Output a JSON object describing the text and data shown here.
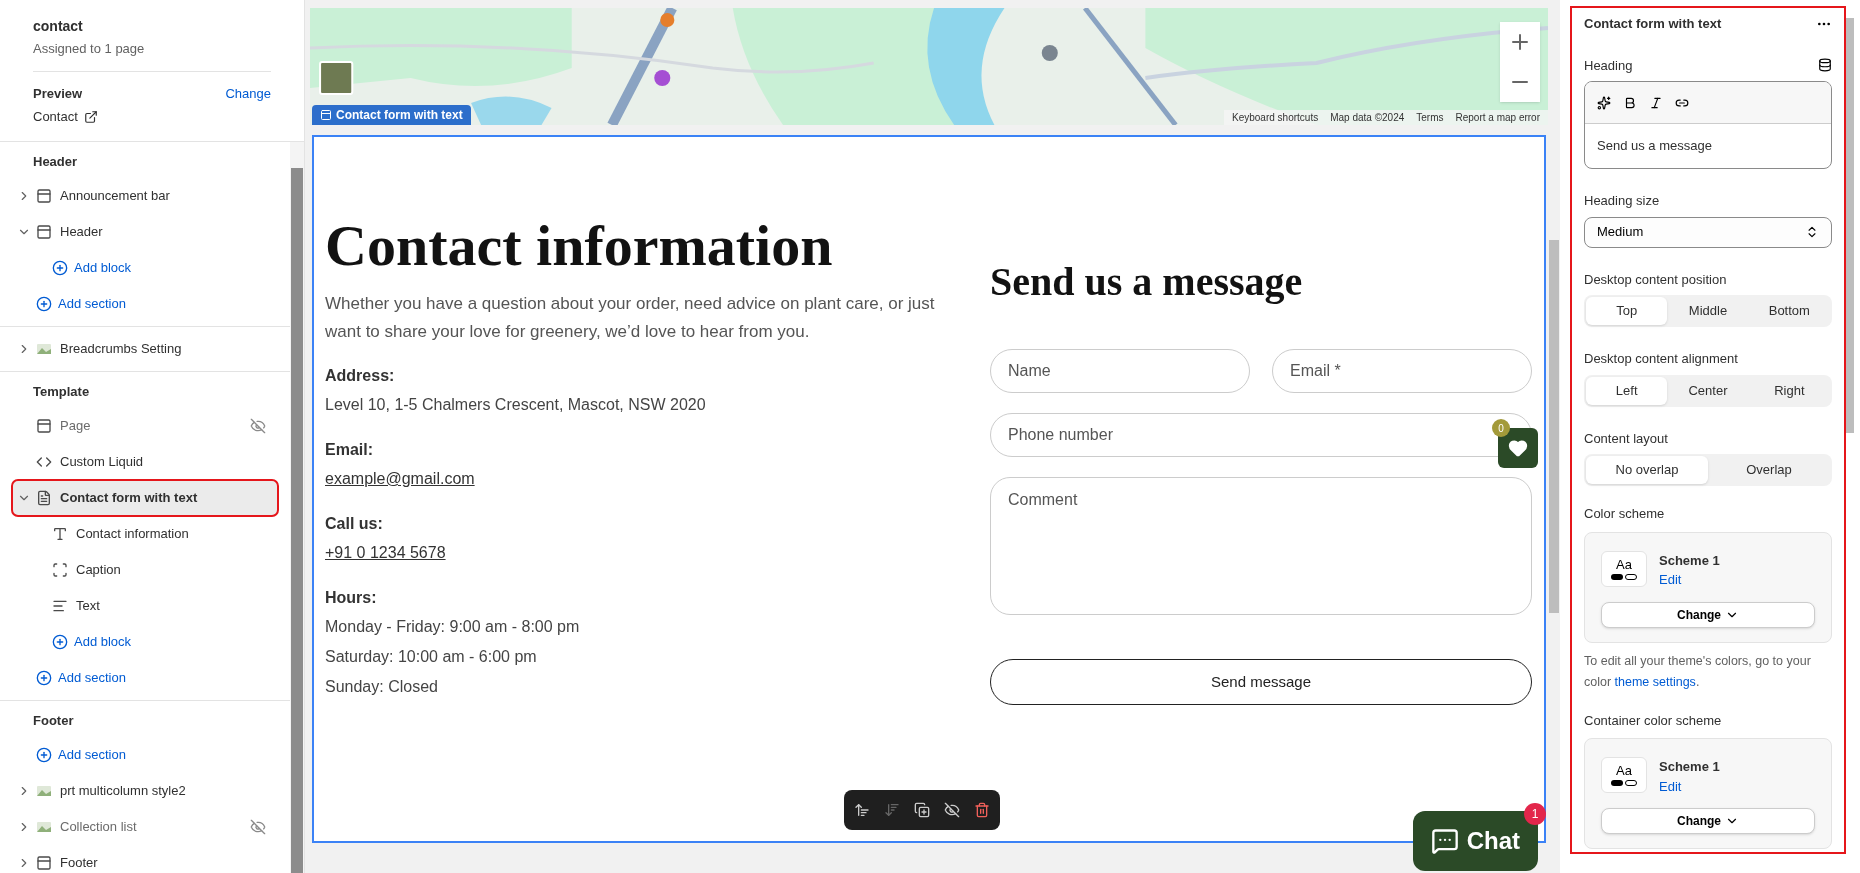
{
  "sidebar": {
    "title": "contact",
    "subtitle": "Assigned to 1 page",
    "preview_label": "Preview",
    "change_link": "Change",
    "preview_page": "Contact",
    "groups": [
      {
        "heading": "Header",
        "items": [
          {
            "kind": "layout",
            "label": "Announcement bar",
            "expanded": false,
            "hidden": false,
            "selected": false
          },
          {
            "kind": "layout",
            "label": "Header",
            "expanded": true,
            "hidden": false,
            "selected": false,
            "children": [
              {
                "kind": "add_block",
                "label": "Add block"
              }
            ]
          },
          {
            "kind": "add_section",
            "label": "Add section"
          }
        ]
      },
      {
        "items": [
          {
            "kind": "thumbnail",
            "label": "Breadcrumbs Setting",
            "expanded": false,
            "hidden": false,
            "selected": false
          }
        ]
      },
      {
        "heading": "Template",
        "items": [
          {
            "kind": "layout",
            "label": "Page",
            "hidden": true,
            "selected": false
          },
          {
            "kind": "code",
            "label": "Custom Liquid",
            "hidden": false,
            "selected": false
          },
          {
            "kind": "form",
            "label": "Contact form with text",
            "expanded": true,
            "hidden": false,
            "selected": true,
            "children": [
              {
                "kind": "heading",
                "label": "Contact information"
              },
              {
                "kind": "caption",
                "label": "Caption"
              },
              {
                "kind": "paragraph",
                "label": "Text"
              },
              {
                "kind": "add_block",
                "label": "Add block"
              }
            ]
          },
          {
            "kind": "add_section",
            "label": "Add section"
          }
        ]
      },
      {
        "heading": "Footer",
        "items": [
          {
            "kind": "add_section",
            "label": "Add section"
          },
          {
            "kind": "thumbnail",
            "label": "prt multicolumn style2",
            "expanded": false,
            "hidden": false,
            "selected": false
          },
          {
            "kind": "thumbnail",
            "label": "Collection list",
            "expanded": false,
            "hidden": true,
            "selected": false
          },
          {
            "kind": "layout",
            "label": "Footer",
            "expanded": false,
            "hidden": false,
            "selected": false
          }
        ]
      }
    ]
  },
  "preview": {
    "map": {
      "kind": "picture",
      "attribution": [
        "Keyboard shortcuts",
        "Map data ©2024",
        "Terms",
        "Report a map error"
      ]
    },
    "section_tag": "Contact form with text",
    "contact": {
      "heading": "Contact information",
      "intro": "Whether you have a question about your order, need advice on plant care, or just want to share your love for greenery, we’d love to hear from you.",
      "details": [
        {
          "label": "Address:",
          "lines": [
            "Level 10, 1-5 Chalmers Crescent, Mascot, NSW 2020"
          ],
          "link": false
        },
        {
          "label": "Email:",
          "lines": [
            "example@gmail.com"
          ],
          "link": true
        },
        {
          "label": "Call us:",
          "lines": [
            "+91 0 1234 5678"
          ],
          "link": true
        },
        {
          "label": "Hours:",
          "lines": [
            "Monday - Friday: 9:00 am - 8:00 pm",
            "Saturday: 10:00 am - 6:00 pm",
            "Sunday: Closed"
          ],
          "link": false
        }
      ]
    },
    "form": {
      "heading": "Send us a message",
      "fields": [
        {
          "kind": "half",
          "placeholder": "Name"
        },
        {
          "kind": "half",
          "placeholder": "Email *"
        },
        {
          "kind": "full",
          "placeholder": "Phone number"
        },
        {
          "kind": "textarea",
          "placeholder": "Comment"
        }
      ],
      "submit": "Send message"
    },
    "wishlist_count": "0",
    "chat": {
      "label": "Chat",
      "badge": "1"
    }
  },
  "settings": {
    "title": "Contact form with text",
    "heading_label": "Heading",
    "heading_value": "Send us a message",
    "size_label": "Heading size",
    "size_value": "Medium",
    "segments": [
      {
        "label": "Desktop content position",
        "options": [
          {
            "label": "Top",
            "selected": true
          },
          {
            "label": "Middle",
            "selected": false
          },
          {
            "label": "Bottom",
            "selected": false
          }
        ]
      },
      {
        "label": "Desktop content alignment",
        "options": [
          {
            "label": "Left",
            "selected": true
          },
          {
            "label": "Center",
            "selected": false
          },
          {
            "label": "Right",
            "selected": false
          }
        ]
      },
      {
        "label": "Content layout",
        "options": [
          {
            "label": "No overlap",
            "selected": true
          },
          {
            "label": "Overlap",
            "selected": false
          }
        ]
      }
    ],
    "schemes": [
      {
        "label": "Color scheme",
        "sample": "Aa",
        "name": "Scheme 1",
        "edit": "Edit",
        "change": "Change",
        "note": "To edit all your theme's colors, go to your color",
        "note_link": "theme settings",
        "note_end": "."
      },
      {
        "label": "Container color scheme",
        "sample": "Aa",
        "name": "Scheme 1",
        "edit": "Edit",
        "change": "Change"
      }
    ]
  }
}
